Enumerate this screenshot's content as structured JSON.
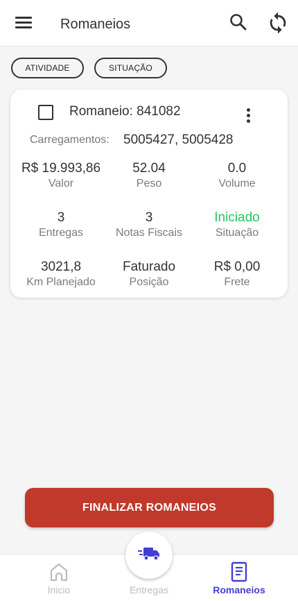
{
  "header": {
    "title": "Romaneios"
  },
  "filters": {
    "atividade": "ATIVIDADE",
    "situacao": "SITUAÇÃO"
  },
  "card": {
    "title": "Romaneio: 841082",
    "carregamentos_label": "Carregamentos:",
    "carregamentos_value": "5005427, 5005428",
    "stats": [
      {
        "value": "R$ 19.993,86",
        "label": "Valor"
      },
      {
        "value": "52.04",
        "label": "Peso"
      },
      {
        "value": "0.0",
        "label": "Volume"
      },
      {
        "value": "3",
        "label": "Entregas"
      },
      {
        "value": "3",
        "label": "Notas Fiscais"
      },
      {
        "value": "Iniciado",
        "label": "Situação"
      },
      {
        "value": "3021,8",
        "label": "Km Planejado"
      },
      {
        "value": "Faturado",
        "label": "Posição"
      },
      {
        "value": "R$ 0,00",
        "label": "Frete"
      }
    ],
    "status_color": "#22c55e"
  },
  "actions": {
    "finalize_label": "FINALIZAR ROMANEIOS",
    "finalize_color": "#c0392b"
  },
  "bottom_nav": {
    "items": [
      {
        "label": "Inicio",
        "icon": "home-icon",
        "active": false
      },
      {
        "label": "Entregas",
        "icon": "truck-icon",
        "active": false
      },
      {
        "label": "Romaneios",
        "icon": "document-icon",
        "active": true
      }
    ],
    "active_color": "#3f3fd0"
  },
  "icons": {
    "menu": "menu-icon",
    "search": "search-icon",
    "sync": "sync-icon",
    "more": "more-vert-icon"
  }
}
